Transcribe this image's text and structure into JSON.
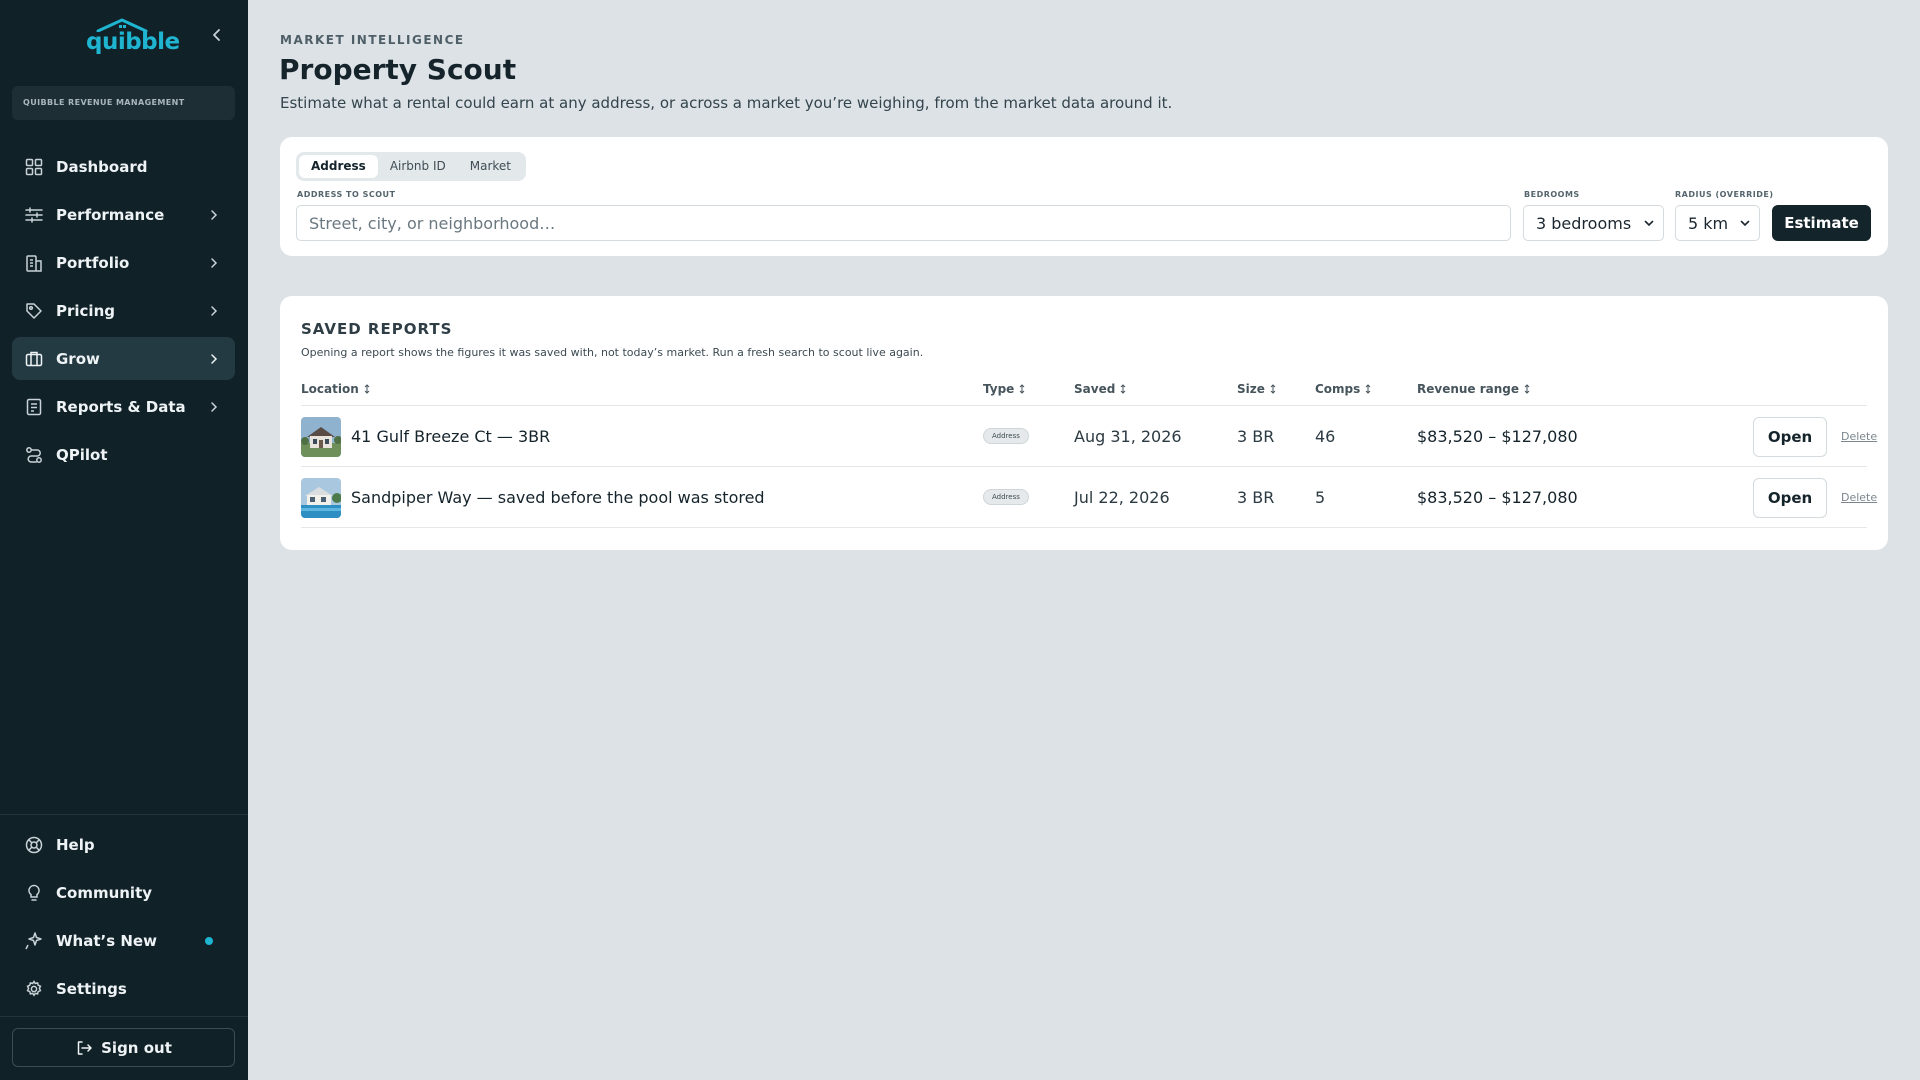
{
  "brand": {
    "name": "quibble",
    "accent": "#1fb5d1"
  },
  "sidebar": {
    "org_label": "QUIBBLE REVENUE MANAGEMENT",
    "items": [
      {
        "label": "Dashboard",
        "icon": "grid-icon"
      },
      {
        "label": "Performance",
        "icon": "sliders-icon"
      },
      {
        "label": "Portfolio",
        "icon": "building-icon"
      },
      {
        "label": "Pricing",
        "icon": "tag-icon"
      },
      {
        "label": "Grow",
        "icon": "briefcase-icon",
        "active": true
      },
      {
        "label": "Reports & Data",
        "icon": "report-icon"
      },
      {
        "label": "QPilot",
        "icon": "route-icon"
      }
    ],
    "bottom_items": [
      {
        "label": "Help",
        "icon": "lifebuoy-icon"
      },
      {
        "label": "Community",
        "icon": "lightbulb-icon"
      },
      {
        "label": "What’s New",
        "icon": "sparkle-icon"
      },
      {
        "label": "Settings",
        "icon": "gear-icon"
      }
    ],
    "signout_label": "Sign out"
  },
  "header": {
    "eyebrow": "MARKET INTELLIGENCE",
    "title": "Property Scout",
    "subtitle": "Estimate what a rental could earn at any address, or across a market you’re weighing, from the market data around it."
  },
  "search": {
    "tabs": [
      "Address",
      "Airbnb ID",
      "Market"
    ],
    "active_tab": "Address",
    "address_label": "ADDRESS TO SCOUT",
    "address_placeholder": "Street, city, or neighborhood…",
    "bedrooms_label": "BEDROOMS",
    "bedrooms_value": "3 bedrooms",
    "radius_label": "RADIUS (OVERRIDE)",
    "radius_value": "5 km",
    "estimate_label": "Estimate"
  },
  "reports": {
    "title": "SAVED REPORTS",
    "subtitle": "Opening a report shows the figures it was saved with, not today’s market. Run a fresh search to scout live again.",
    "columns": [
      "Location",
      "Type",
      "Saved",
      "Size",
      "Comps",
      "Revenue range"
    ],
    "rows": [
      {
        "location": "41 Gulf Breeze Ct — 3BR",
        "type": "Address",
        "saved": "Aug 31, 2026",
        "size": "3 BR",
        "comps": "46",
        "revenue": "$83,520 – $127,080",
        "open": "Open",
        "delete": "Delete"
      },
      {
        "location": "Sandpiper Way — saved before the pool was stored",
        "type": "Address",
        "saved": "Jul 22, 2026",
        "size": "3 BR",
        "comps": "5",
        "revenue": "$83,520 – $127,080",
        "open": "Open",
        "delete": "Delete"
      }
    ]
  }
}
